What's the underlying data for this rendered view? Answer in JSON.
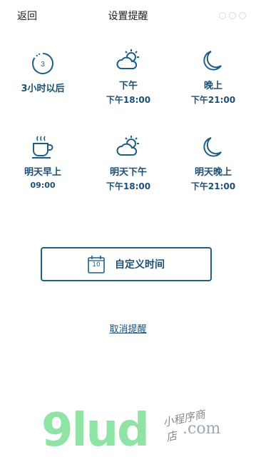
{
  "nav": {
    "back_label": "返回",
    "title": "设置提醒"
  },
  "options": [
    {
      "icon": "timer-icon",
      "line1": "3小时以后",
      "line2": "",
      "badge": "3"
    },
    {
      "icon": "partly-cloudy-sun-icon",
      "line1": "下午",
      "line2": "下午18:00"
    },
    {
      "icon": "crescent-moon-icon",
      "line1": "晚上",
      "line2": "下午21:00"
    },
    {
      "icon": "coffee-cup-icon",
      "line1": "明天早上",
      "line2": "09:00"
    },
    {
      "icon": "partly-cloudy-sun-icon",
      "line1": "明天下午",
      "line2": "下午18:00"
    },
    {
      "icon": "crescent-moon-icon",
      "line1": "明天晚上",
      "line2": "下午21:00"
    }
  ],
  "custom_time": {
    "label": "自定义时间",
    "calendar_day": "10"
  },
  "cancel_label": "取消提醒",
  "watermark": {
    "brand": "9lud",
    "small": "小程序商店",
    "domain": ".com"
  },
  "colors": {
    "accent": "#1d4f73",
    "border": "#1f5e86",
    "watermark_green": "#8fe3a5"
  }
}
